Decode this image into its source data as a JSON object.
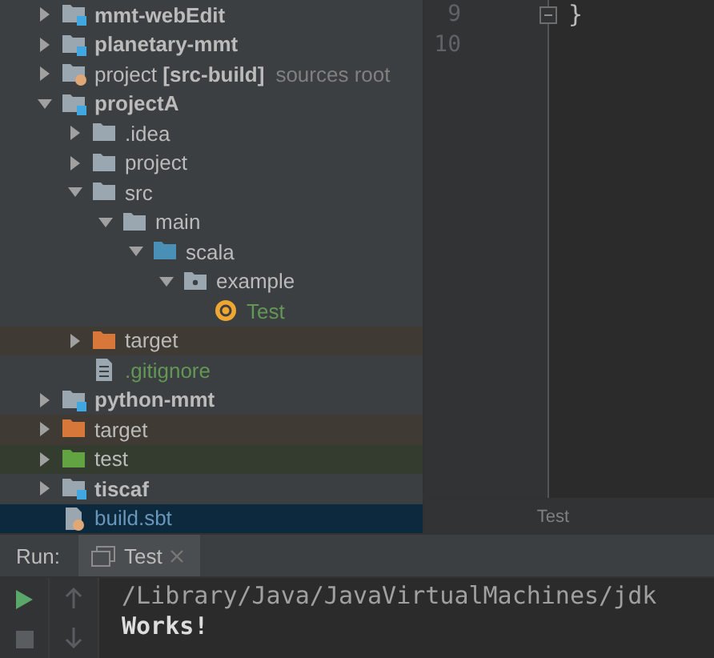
{
  "project_tree": [
    {
      "name": "mmt-webEdit",
      "kind": "module",
      "expanded": false,
      "selected": false
    },
    {
      "name": "planetary-mmt",
      "kind": "module",
      "expanded": false,
      "selected": false
    },
    {
      "name": "project **[src-build]**",
      "kind": "build-module",
      "hint": "sources root",
      "expanded": false,
      "selected": false
    },
    {
      "name": "projectA",
      "kind": "module",
      "expanded": true,
      "selected": false,
      "children": [
        {
          "name": ".idea",
          "kind": "folder",
          "expanded": false,
          "selected": false
        },
        {
          "name": "project",
          "kind": "folder",
          "expanded": false,
          "selected": false
        },
        {
          "name": "src",
          "kind": "folder",
          "expanded": true,
          "selected": false,
          "children": [
            {
              "name": "main",
              "kind": "folder",
              "expanded": true,
              "selected": false,
              "children": [
                {
                  "name": "scala",
                  "kind": "source-folder",
                  "expanded": true,
                  "selected": false,
                  "children": [
                    {
                      "name": "example",
                      "kind": "package",
                      "expanded": true,
                      "selected": false,
                      "children": [
                        {
                          "name": "Test",
                          "kind": "class",
                          "color": "#629755",
                          "selected": false
                        }
                      ]
                    }
                  ]
                }
              ]
            }
          ]
        },
        {
          "name": "target",
          "kind": "excluded-folder",
          "expanded": false,
          "selected": false
        },
        {
          "name": ".gitignore",
          "kind": "file",
          "color": "#629755",
          "selected": false
        }
      ]
    },
    {
      "name": "python-mmt",
      "kind": "module",
      "expanded": false,
      "selected": false
    },
    {
      "name": "target",
      "kind": "excluded-folder",
      "expanded": false,
      "selected": false
    },
    {
      "name": "test",
      "kind": "test-folder",
      "expanded": false,
      "selected": false
    },
    {
      "name": "tiscaf",
      "kind": "module",
      "expanded": false,
      "selected": false
    },
    {
      "name": "build.sbt",
      "kind": "sbt-file",
      "color": "#6897bb",
      "selected": true
    }
  ],
  "editor": {
    "lines": [
      {
        "number": "9",
        "code": "}",
        "fold": true
      },
      {
        "number": "10"
      }
    ],
    "breadcrumb": "Test"
  },
  "run_panel": {
    "label": "Run:",
    "tabs": [
      {
        "title": "Test",
        "selected": true
      }
    ],
    "console": [
      {
        "text": "/Library/Java/JavaVirtualMachines/jdk",
        "kind": "command"
      },
      {
        "text": "Works!",
        "kind": "output"
      }
    ]
  }
}
